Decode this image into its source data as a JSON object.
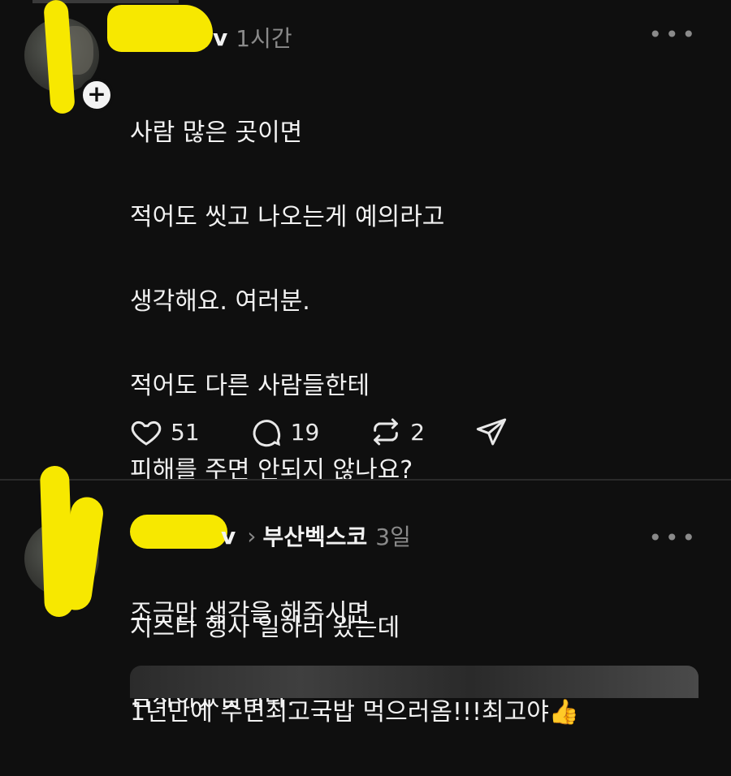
{
  "post1": {
    "username_tail": "v",
    "time": "1시간",
    "more_icon": "more-horizontal-icon",
    "lines": [
      "사람 많은 곳이면",
      "적어도 씻고 나오는게 예의라고",
      "생각해요. 여러분.",
      "적어도 다른 사람들한테",
      "피해를 주면 안되지 않나요?",
      "",
      "조금만 생각을 해주시면",
      "감사하겠습니다."
    ],
    "likes": "51",
    "comments": "19",
    "reposts": "2"
  },
  "post2": {
    "username_tail": "v",
    "community": "부산벡스코",
    "time": "3일",
    "lines": [
      "지스타 행사 일하러 왔는데",
      "1년만에 수변최고국밥 먹으러옴!!!최고야👍"
    ]
  },
  "colors": {
    "background": "#0f0f0f",
    "text": "#f2f2f2",
    "muted": "#8a8a8a",
    "redaction": "#f7e800"
  }
}
